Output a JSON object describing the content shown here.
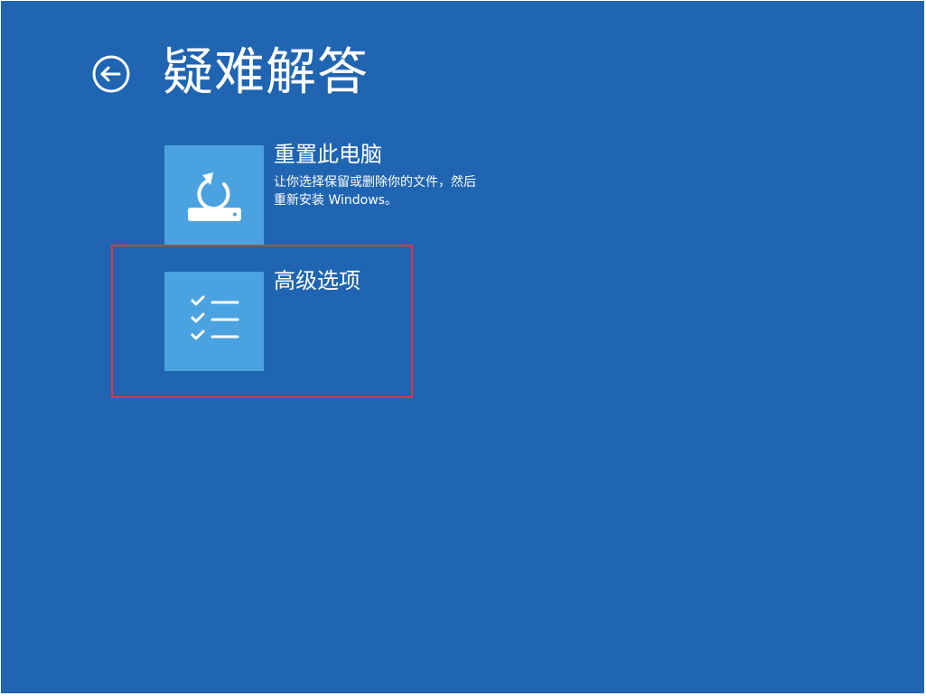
{
  "header": {
    "title": "疑难解答",
    "back_icon": "back-arrow-icon"
  },
  "options": [
    {
      "title": "重置此电脑",
      "description_lines": [
        "让你选择保留或删除你的文件，然后",
        "重新安装 Windows。"
      ],
      "icon": "reset-pc-icon"
    },
    {
      "title": "高级选项",
      "description_lines": [],
      "icon": "checklist-icon"
    }
  ],
  "colors": {
    "background": "#1f65b2",
    "tile": "#4aa3e0",
    "text": "#ffffff",
    "highlight_border": "#e8323e"
  }
}
